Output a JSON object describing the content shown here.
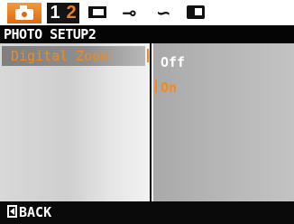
{
  "tabs": {
    "items": [
      {
        "name": "camera",
        "icon": "camera-icon",
        "active": true
      },
      {
        "name": "setup-1",
        "label": "1"
      },
      {
        "name": "setup-2",
        "label": "2",
        "active": true
      },
      {
        "name": "frame",
        "icon": "frame-icon"
      },
      {
        "name": "key",
        "icon": "key-icon"
      },
      {
        "name": "curve",
        "icon": "curve-icon"
      },
      {
        "name": "playback",
        "icon": "playback-icon"
      }
    ]
  },
  "header": {
    "title": "PHOTO SETUP2"
  },
  "menu": {
    "items": [
      {
        "label": "Digital Zoom",
        "selected": true
      }
    ]
  },
  "options": {
    "items": [
      {
        "label": "Off",
        "selected": false
      },
      {
        "label": "On",
        "selected": true
      }
    ]
  },
  "footer": {
    "back_label": "BACK"
  },
  "colors": {
    "accent": "#f28a21",
    "tab_bar": "#ffffff",
    "bar_dark": "#050505"
  }
}
